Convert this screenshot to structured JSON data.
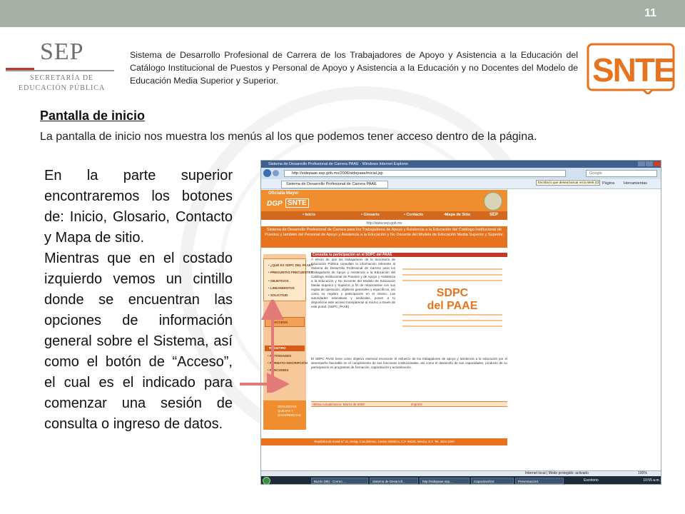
{
  "page_number": "11",
  "sep": {
    "word": "SEP",
    "line1": "SECRETARÍA DE",
    "line2": "EDUCACIÓN PÚBLICA"
  },
  "header_description": "Sistema de Desarrollo Profesional de Carrera de los Trabajadores de Apoyo y Asistencia a la Educación  del Catálogo Institucional de Puestos y Personal de Apoyo y Asistencia a la Educación y no Docentes del Modelo de Educación Media Superior y Superior.",
  "snte_logo_text": "SNTE",
  "section": {
    "title": "Pantalla de inicio",
    "description": "La pantalla de inicio nos muestra  los menús al los que podemos tener acceso dentro de la página."
  },
  "body_paragraphs": [
    "En la parte superior encontraremos los botones de: Inicio, Glosario, Contacto y Mapa de sitio.",
    "Mientras que en el costado izquierdo vemos un cintillo donde se encuentran las opciones de información general sobre el Sistema, así como el botón de “Acceso”, el cual es el indicado para comenzar una sesión de consulta o ingreso de datos."
  ],
  "screenshot": {
    "window_title": "Sistema de Desarrollo Profesional de Carrera PAAE - Windows Internet Explorer",
    "url": "http://sidepaae.sep.gob.mx/2006/sidepaae/inicial.jsp",
    "search_placeholder": "Google",
    "tab_label": "Sistema de Desarrollo Profesional de Carrera PAAE",
    "tooltip": "Escriba lo que desea buscar en la Web (Ctrl+E)",
    "toolbar_page": "Página",
    "toolbar_tools": "Herramientas",
    "site": {
      "oficialia": "Oficialía Mayor",
      "dgp": "DGP",
      "snte": "SNTE",
      "nav": [
        "• Inicio",
        "• Glosario",
        "• Contacto",
        "•Mapa de Sitio"
      ],
      "nav_sep": "SEP",
      "url_line": "http://www.sep.gob.mx",
      "banner": "Sistema de Desarrollo Profesional de Carrera para los Trabajadores de Apoyo y Asistencia a la Educación del Catálogo Institucional de Puestos y también del Personal de Apoyo y Asistencia a la Educación y No Docente del Modelo de Educación Media Superior y Superior.",
      "side_items": [
        "• ¿QUÉ ES SDPC DEL PAAE?",
        "• PREGUNTAS FRECUENTES",
        "• OBJETIVOS",
        "• LINEAMIENTOS",
        "• SOLICITUD"
      ],
      "side_access": "ACCESO",
      "side_registro": "REGISTRO",
      "side_items2": [
        "• ACTIVIDADES",
        "• FORMATO INSCRIPCIÓN",
        "• FUNCIONES"
      ],
      "side_bottom": [
        "DENUNCIAS",
        "QUEJAS Y",
        "SUGERENCIAS"
      ],
      "news_head": "Consulta tu participación en el SDPC del PAAE",
      "news_body": "A efecto de que los trabajadores de la Secretaría de Educación Pública consulten la información referente al Sistema de Desarrollo Profesional de Carrera para los Trabajadores de Apoyo y Asistencia a la Educación del Catálogo Institucional de Puestos y de Apoyo y Asistencia a la Educación y No Docente del Modelo de Educación Media Superior y Superior, a fin de relacionarse con sus reglas de operación, objetivos generales y específicos, así como su registro y participación en el mismo. Las autoridades educativas y sindicales, ponen a tu disposición este acceso transparente al mismo a través de este portal. (SDPC_PAAE)",
      "sdpc_line1": "SDPC",
      "sdpc_line2": "del PAAE",
      "news_body2": "El SDPC PAAE tiene como objetivo esencial reconocer el esfuerzo de los trabajadores de apoyo y asistencia a la educación por el desempeño favorable en el cumplimiento de sus funciones institucionales, así como el desarrollo de sus capacidades, producto de su participación en programas de formación, capacitación y actualización.",
      "update": "Última Actualización, Marzo de 2008",
      "print": "imprimir",
      "footer": "República de Brasil N° 31, Delog. Cuauhtémoc, Centro Histórico, C.P. 06020, México, D.F. Tel. 3003-1000"
    },
    "status": "Internet local | Modo protegido: activado",
    "zoom": "100%",
    "taskbar": [
      "Buzón (86) - Correo ...",
      "Sistema de Desarroll...",
      "http://sidepaae.sep....",
      "Capacitación3",
      "Presentación1"
    ],
    "taskbar_right": "Escritorio",
    "clock": "10:55 a.m."
  },
  "colors": {
    "topbar": "#a7b0a6",
    "snte_orange": "#e8731e",
    "site_orange": "#f08d2e",
    "accent_red": "#c0392b"
  }
}
